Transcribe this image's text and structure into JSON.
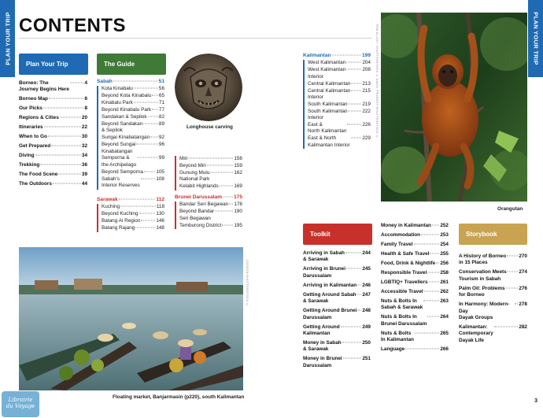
{
  "side_tabs": {
    "left": "PLAN YOUR TRIP",
    "right": "PLAN YOUR TRIP"
  },
  "title": "CONTENTS",
  "sections": {
    "plan": "Plan Your Trip",
    "guide": "The Guide",
    "toolkit": "Toolkit",
    "storybook": "Storybook"
  },
  "plan_items": [
    {
      "t": "Borneo: The\nJourney Begins Here",
      "p": "4"
    },
    {
      "t": "Borneo Map",
      "p": "6"
    },
    {
      "t": "Our Picks",
      "p": "8"
    },
    {
      "t": "Regions & Cities",
      "p": "20"
    },
    {
      "t": "Itineraries",
      "p": "22"
    },
    {
      "t": "When to Go",
      "p": "30"
    },
    {
      "t": "Get Prepared",
      "p": "32"
    },
    {
      "t": "Diving",
      "p": "34"
    },
    {
      "t": "Trekking",
      "p": "36"
    },
    {
      "t": "The Food Scene",
      "p": "39"
    },
    {
      "t": "The Outdoors",
      "p": "44"
    }
  ],
  "sabah": {
    "name": "Sabah",
    "p": "51",
    "items": [
      {
        "t": "Kota Kinabalu",
        "p": "56"
      },
      {
        "t": "Beyond Kota Kinabalu",
        "p": "65"
      },
      {
        "t": "Kinabalu Park",
        "p": "71"
      },
      {
        "t": "Beyond Kinabalu Park",
        "p": "77"
      },
      {
        "t": "Sandakan & Sepilok",
        "p": "82"
      },
      {
        "t": "Beyond Sandakan\n& Sepilok",
        "p": "89"
      },
      {
        "t": "Sungai Kinabatangan",
        "p": "92"
      },
      {
        "t": "Beyond Sungai\nKinabatangan",
        "p": "96"
      },
      {
        "t": "Semporna &\nthe Archipelago",
        "p": "99"
      },
      {
        "t": "Beyond Semporna",
        "p": "105"
      },
      {
        "t": "Sabah's\nInterior Reserves",
        "p": "108"
      }
    ]
  },
  "sarawak": {
    "name": "Sarawak",
    "p": "112",
    "items": [
      {
        "t": "Kuching",
        "p": "118"
      },
      {
        "t": "Beyond Kuching",
        "p": "130"
      },
      {
        "t": "Batang Ai Region",
        "p": "146"
      },
      {
        "t": "Batang Rajang",
        "p": "148"
      }
    ]
  },
  "sarawak_cont": [
    {
      "t": "Miri",
      "p": "156"
    },
    {
      "t": "Beyond Miri",
      "p": "159"
    },
    {
      "t": "Gunung Mulu\nNational Park",
      "p": "162"
    },
    {
      "t": "Kelabit Highlands",
      "p": "169"
    }
  ],
  "brunei": {
    "name": "Brunei Darussalam",
    "p": "175",
    "items": [
      {
        "t": "Bandar Seri Begawan",
        "p": "178"
      },
      {
        "t": "Beyond Bandar\nSeri Begawan",
        "p": "190"
      },
      {
        "t": "Temburong District",
        "p": "195"
      }
    ]
  },
  "kalimantan": {
    "name": "Kalimantan",
    "p": "199",
    "items": [
      {
        "t": "West Kalimantan",
        "p": "204"
      },
      {
        "t": "West Kalimantan\nInterior",
        "p": "208"
      },
      {
        "t": "Central Kalimantan",
        "p": "213"
      },
      {
        "t": "Central Kalimantan\nInterior",
        "p": "215"
      },
      {
        "t": "South Kalimantan",
        "p": "219"
      },
      {
        "t": "South Kalimantan\nInterior",
        "p": "222"
      },
      {
        "t": "East &\nNorth Kalimantan",
        "p": "226"
      },
      {
        "t": "East & North\nKalimantan Interior",
        "p": "229"
      }
    ]
  },
  "toolkit_items": [
    {
      "t": "Arriving in Sabah\n& Sarawak",
      "p": "244"
    },
    {
      "t": "Arriving in Brunei\nDarussalam",
      "p": "245"
    },
    {
      "t": "Arriving in Kalimantan",
      "p": "246"
    },
    {
      "t": "Getting Around Sabah\n& Sarawak",
      "p": "247"
    },
    {
      "t": "Getting Around Brunei\nDarussalam",
      "p": "248"
    },
    {
      "t": "Getting Around\nKalimantan",
      "p": "249"
    },
    {
      "t": "Money in Sabah\n& Sarawak",
      "p": "250"
    },
    {
      "t": "Money in Brunei\nDarussalam",
      "p": "251"
    }
  ],
  "toolkit_items_2": [
    {
      "t": "Money in Kalimantan",
      "p": "252"
    },
    {
      "t": "Accommodation",
      "p": "253"
    },
    {
      "t": "Family Travel",
      "p": "254"
    },
    {
      "t": "Health & Safe Travel",
      "p": "255"
    },
    {
      "t": "Food, Drink & Nightlife",
      "p": "256"
    },
    {
      "t": "Responsible Travel",
      "p": "258"
    },
    {
      "t": "LGBTIQ+ Travellers",
      "p": "261"
    },
    {
      "t": "Accessible Travel",
      "p": "262"
    },
    {
      "t": "Nuts & Bolts In\nSabah & Sarawak",
      "p": "263"
    },
    {
      "t": "Nuts & Bolts In\nBrunei Darussalam",
      "p": "264"
    },
    {
      "t": "Nuts & Bolts\nIn Kalimantan",
      "p": "265"
    },
    {
      "t": "Language",
      "p": "266"
    }
  ],
  "storybook_items": [
    {
      "t": "A History of Borneo\nin 15 Places",
      "p": "270"
    },
    {
      "t": "Conservation Meets\nTourism in Sabah",
      "p": "274"
    },
    {
      "t": "Palm Oil: Problems\nfor Borneo",
      "p": "276"
    },
    {
      "t": "In Harmony: Modern-Day\nDayak Groups",
      "p": "278"
    },
    {
      "t": "Kalimantan:\nContemporary\nDayak Life",
      "p": "282"
    }
  ],
  "captions": {
    "carving": "Longhouse carving",
    "orangutan": "Orangutan",
    "market": "Floating market, Banjarmasin (p220), south Kalimantan"
  },
  "credits": {
    "orangutan": "TOM ALLEN / SHUTTERSTOCK © DAVID PROBERT/SHUTTERSTOCK ©",
    "market": "IDESIGN/SHUTTERSTOCK ©"
  },
  "page_number": "3",
  "watermark": "Librairie du Voyage"
}
